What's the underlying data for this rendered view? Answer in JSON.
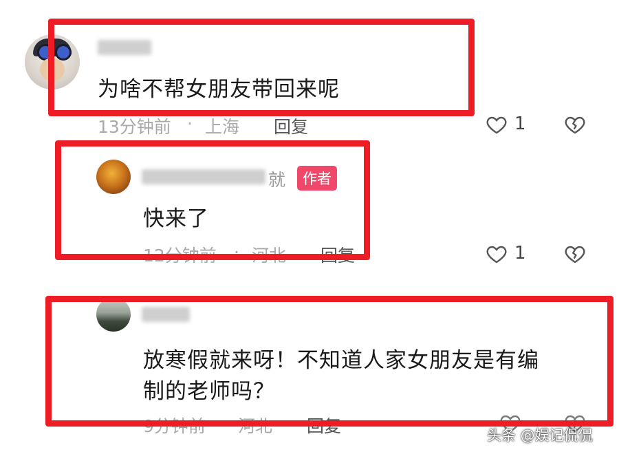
{
  "comments": [
    {
      "text": "为啥不帮女朋友带回来呢",
      "time": "13分钟前",
      "separator": "·",
      "location": "上海",
      "reply_label": "回复",
      "likes": "1",
      "username": "",
      "badge": ""
    },
    {
      "text": "快来了",
      "time": "12分钟前",
      "separator": "·",
      "location": "河北",
      "reply_label": "回复",
      "likes": "1",
      "username": "",
      "name_tail": "就",
      "badge": "作者"
    },
    {
      "text_line1": "放寒假就来呀！不知道人家女朋友是有编",
      "text_line2": "制的老师吗？",
      "time": "9分钟前",
      "separator": "·",
      "location": "河北",
      "reply_label": "回复",
      "likes": "",
      "username": ""
    }
  ],
  "icons": {
    "like": "heart-outline-icon",
    "dislike": "broken-heart-icon"
  },
  "watermark": "头条 @娱记侃侃",
  "colors": {
    "highlight_box": "#ee1c24",
    "author_badge": "#f0486b"
  }
}
